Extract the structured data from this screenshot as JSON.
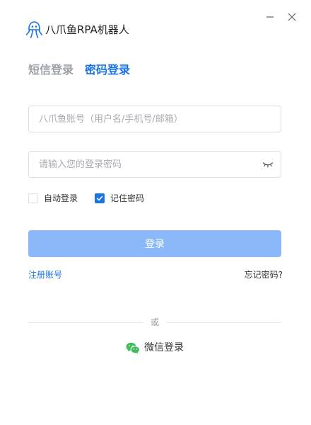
{
  "app": {
    "title": "八爪鱼RPA机器人",
    "logo_icon": "octopus-robot-icon",
    "brand_color": "#1a73e8"
  },
  "window_controls": {
    "minimize_icon": "minimize-icon",
    "close_icon": "close-icon"
  },
  "tabs": [
    {
      "label": "短信登录",
      "active": false
    },
    {
      "label": "密码登录",
      "active": true
    }
  ],
  "form": {
    "account": {
      "value": "",
      "placeholder": "八爪鱼账号（用户名/手机号/邮箱）"
    },
    "password": {
      "value": "",
      "placeholder": "请输入您的登录密码",
      "toggle_icon": "eye-closed-icon"
    },
    "auto_login": {
      "label": "自动登录",
      "checked": false
    },
    "remember_password": {
      "label": "记住密码",
      "checked": true
    },
    "submit_label": "登录",
    "submit_color": "#8ab8f8"
  },
  "links": {
    "register": "注册账号",
    "forgot_password": "忘记密码?"
  },
  "divider_text": "或",
  "wechat": {
    "label": "微信登录",
    "icon": "wechat-icon",
    "icon_color": "#3ebb5b"
  }
}
